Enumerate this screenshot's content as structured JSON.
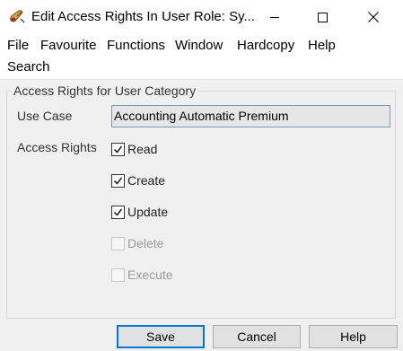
{
  "window": {
    "title": "Edit Access Rights In User Role: Sy...",
    "icon": "scroll-feather-icon"
  },
  "menu": [
    "File",
    "Favourite",
    "Functions",
    "Window",
    "Hardcopy",
    "Help",
    "Search"
  ],
  "group": {
    "title": "Access Rights for User Category",
    "use_case_label": "Use Case",
    "use_case_value": "Accounting Automatic Premium",
    "access_rights_label": "Access Rights",
    "rights": [
      {
        "label": "Read",
        "checked": true,
        "enabled": true
      },
      {
        "label": "Create",
        "checked": true,
        "enabled": true
      },
      {
        "label": "Update",
        "checked": true,
        "enabled": true
      },
      {
        "label": "Delete",
        "checked": false,
        "enabled": false
      },
      {
        "label": "Execute",
        "checked": false,
        "enabled": false
      }
    ]
  },
  "buttons": {
    "save": "Save",
    "cancel": "Cancel",
    "help": "Help"
  },
  "colors": {
    "accent": "#0078d7",
    "dialog_bg": "#f0f0f0"
  }
}
